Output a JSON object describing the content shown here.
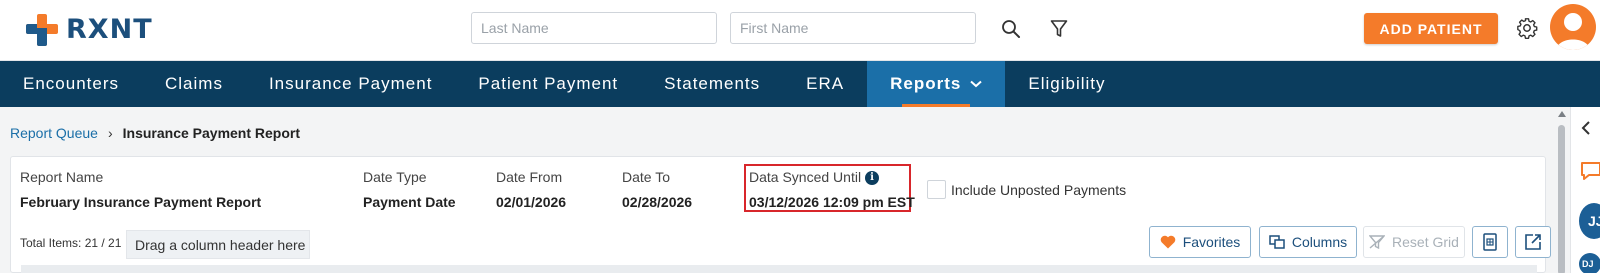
{
  "brand": {
    "name": "RXNT"
  },
  "search": {
    "last_name_placeholder": "Last Name",
    "first_name_placeholder": "First Name"
  },
  "header": {
    "add_patient_label": "ADD PATIENT"
  },
  "nav": {
    "items": [
      {
        "label": "Encounters"
      },
      {
        "label": "Claims"
      },
      {
        "label": "Insurance Payment"
      },
      {
        "label": "Patient Payment"
      },
      {
        "label": "Statements"
      },
      {
        "label": "ERA"
      },
      {
        "label": "Reports",
        "active": true
      },
      {
        "label": "Eligibility"
      }
    ]
  },
  "breadcrumb": {
    "parent": "Report Queue",
    "current": "Insurance Payment Report"
  },
  "report": {
    "name_label": "Report Name",
    "name_value": "February Insurance Payment Report",
    "date_type_label": "Date Type",
    "date_type_value": "Payment Date",
    "date_from_label": "Date From",
    "date_from_value": "02/01/2026",
    "date_to_label": "Date To",
    "date_to_value": "02/28/2026",
    "synced_label": "Data Synced Until",
    "synced_value": "03/12/2026 12:09 pm EST",
    "include_unposted_label": "Include Unposted Payments",
    "include_unposted_checked": false
  },
  "grid": {
    "total_items": "Total Items: 21 / 21",
    "group_placeholder": "Drag a column header here",
    "buttons": {
      "favorites": "Favorites",
      "columns": "Columns",
      "reset_grid": "Reset Grid"
    }
  },
  "rail": {
    "avatar_initials": "JJ",
    "small_initials": "DJ"
  },
  "colors": {
    "accent": "#f47b2a",
    "nav_bg": "#0b3d5e",
    "nav_active": "#1b6fa8",
    "link": "#1b6fa8",
    "highlight_border": "#d8262b"
  }
}
